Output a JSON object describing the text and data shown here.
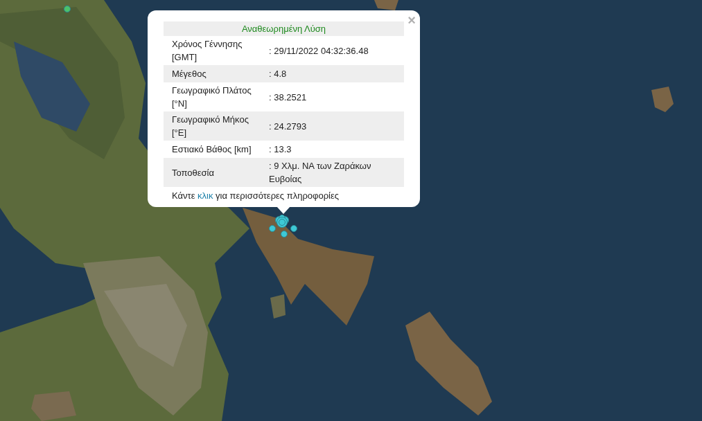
{
  "popup": {
    "title": "Αναθεωρημένη Λύση",
    "close": "×",
    "rows": [
      {
        "label": "Χρόνος Γέννησης [GMT]",
        "value": ": 29/11/2022 04:32:36.48"
      },
      {
        "label": "Μέγεθος",
        "value": ": 4.8"
      },
      {
        "label": "Γεωγραφικό Πλάτος [°N]",
        "value": ": 38.2521"
      },
      {
        "label": "Γεωγραφικό Μήκος [°E]",
        "value": ": 24.2793"
      },
      {
        "label": "Εστιακό Βάθος [km]",
        "value": ": 13.3"
      },
      {
        "label": "Τοποθεσία",
        "value": ": 9 Χλμ. ΝΑ των Ζαράκων Ευβοίας"
      }
    ],
    "footer": {
      "before": "Κάντε ",
      "link": "κλικ",
      "after": " για περισσότερες πληροφορίες"
    }
  },
  "markers": [
    {
      "kind": "cluster",
      "color": "#3ec9d6"
    },
    {
      "kind": "single",
      "color": "#3ec9d6"
    },
    {
      "kind": "single",
      "color": "#3ec9d6"
    },
    {
      "kind": "single",
      "color": "#3ec9d6"
    },
    {
      "kind": "single",
      "color": "#4cc26a"
    }
  ]
}
